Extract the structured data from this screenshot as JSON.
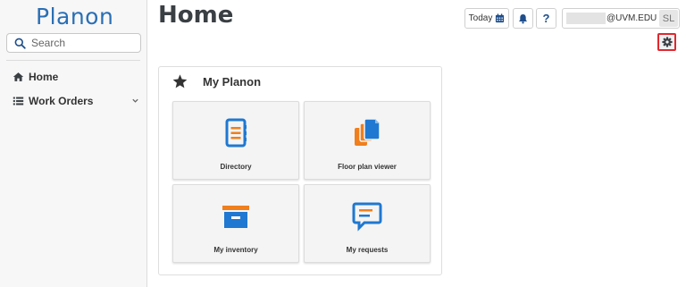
{
  "brand": {
    "logo_text": "Planon"
  },
  "search": {
    "placeholder": "Search"
  },
  "nav": {
    "items": [
      {
        "label": "Home",
        "icon": "home-icon"
      },
      {
        "label": "Work Orders",
        "icon": "list-icon",
        "expandable": true
      }
    ]
  },
  "header": {
    "title": "Home",
    "today_label": "Today",
    "help_label": "?",
    "user_email": "@UVM.EDU",
    "user_initials": "SL"
  },
  "panel": {
    "title": "My Planon",
    "tiles": [
      {
        "label": "Directory",
        "icon": "directory-icon"
      },
      {
        "label": "Floor plan viewer",
        "icon": "floor-plan-icon"
      },
      {
        "label": "My inventory",
        "icon": "inventory-box-icon"
      },
      {
        "label": "My requests",
        "icon": "requests-chat-icon"
      }
    ]
  },
  "colors": {
    "brand_blue": "#2a6fb5",
    "accent_orange": "#f07f1c",
    "tile_blue": "#1f78d1",
    "highlight_red": "#e0282e"
  }
}
